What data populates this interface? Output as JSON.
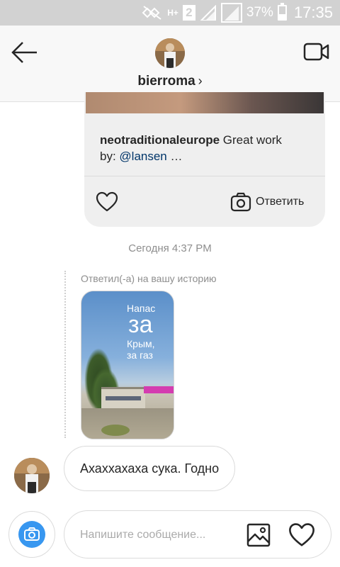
{
  "status_bar": {
    "network_type": "H+",
    "sim_slot": "2",
    "battery_percent": "37%",
    "battery_level": 0.37,
    "time": "17:35",
    "background_color": "#d2d2d2"
  },
  "header": {
    "username": "bierroma",
    "chevron": "›",
    "icons": {
      "back": "back-arrow-icon",
      "video": "video-camera-icon"
    }
  },
  "shared_post": {
    "author": "neotraditionaleurope",
    "caption_text": " Great work",
    "caption_by": "by: ",
    "mention": "@lansen",
    "ellipsis": " …",
    "reply_label": "Ответить"
  },
  "timestamp": "Сегодня 4:37 PM",
  "story_reply": {
    "caption": "Ответил(-а) на вашу историю",
    "story_text_line1": "Напас",
    "story_text_line2": "за",
    "story_text_line3": "Крым, за газ"
  },
  "message": {
    "text": "Ахаххахаха сука. Годно"
  },
  "composer": {
    "placeholder": "Напишите сообщение...",
    "icons": {
      "camera": "camera-icon",
      "gallery": "gallery-icon",
      "like": "heart-icon"
    }
  },
  "colors": {
    "accent": "#3897f0",
    "mention": "#003569",
    "muted_text": "#8e8e8e"
  }
}
